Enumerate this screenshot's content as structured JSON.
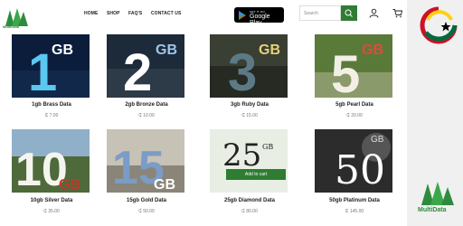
{
  "brand": {
    "name": "MultiData",
    "logo_caption": "MultiData"
  },
  "nav": [
    "HOME",
    "SHOP",
    "FAQ'S",
    "CONTACT US"
  ],
  "store_badge": {
    "small": "GET IT ON",
    "big": "Google Play"
  },
  "search": {
    "placeholder": "Search"
  },
  "products": [
    {
      "title": "1gb Brass Data",
      "price": "₵ 7.00",
      "num": "1",
      "unit": "GB"
    },
    {
      "title": "2gb Bronze Data",
      "price": "₵ 10.00",
      "num": "2",
      "unit": "GB"
    },
    {
      "title": "3gb Ruby Data",
      "price": "₵ 15.00",
      "num": "3",
      "unit": "GB"
    },
    {
      "title": "5gb Pearl Data",
      "price": "₵ 20.00",
      "num": "5",
      "unit": "GB"
    },
    {
      "title": "10gb Silver Data",
      "price": "₵ 35.00",
      "num": "10",
      "unit": "GB"
    },
    {
      "title": "15gb Gold Data",
      "price": "₵ 50.00",
      "num": "15",
      "unit": "GB"
    },
    {
      "title": "25gb Diamond Data",
      "price": "₵ 80.00",
      "num": "25",
      "unit": "GB"
    },
    {
      "title": "50gb Platinum Data",
      "price": "₵ 145.00",
      "num": "50",
      "unit": "GB"
    }
  ],
  "add_to_cart_label": "Add to cart",
  "colors": {
    "accent": "#2e7d32",
    "ghana_red": "#ce1126",
    "ghana_gold": "#fcd116",
    "ghana_green": "#006b3f"
  }
}
